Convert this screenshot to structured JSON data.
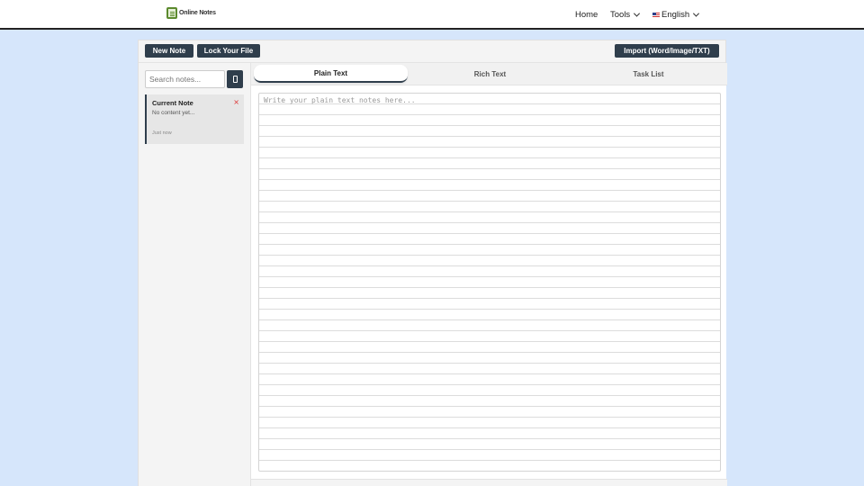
{
  "header": {
    "logo_text": "Online Notes",
    "nav": {
      "home": "Home",
      "tools": "Tools",
      "language": "English"
    }
  },
  "toolbar": {
    "new_note": "New Note",
    "lock_file": "Lock Your File",
    "import": "Import (Word/Image/TXT)"
  },
  "sidebar": {
    "search_placeholder": "Search notes...",
    "notes": [
      {
        "title": "Current Note",
        "preview": "No content yet...",
        "time": "Just now"
      }
    ]
  },
  "tabs": [
    {
      "label": "Plain Text",
      "active": true
    },
    {
      "label": "Rich Text",
      "active": false
    },
    {
      "label": "Task List",
      "active": false
    }
  ],
  "editor": {
    "placeholder": "Write your plain text notes here..."
  },
  "colors": {
    "page_bg": "#d6e6fb",
    "button_bg": "#2f3e4c",
    "close_red": "#dd3333"
  }
}
